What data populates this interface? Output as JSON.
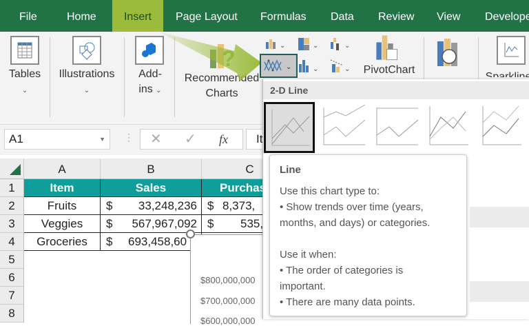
{
  "tabs": [
    "File",
    "Home",
    "Insert",
    "Page Layout",
    "Formulas",
    "Data",
    "Review",
    "View",
    "Develope"
  ],
  "active_tab": "Insert",
  "ribbon": {
    "tables": "Tables",
    "illustrations": "Illustrations",
    "addins_1": "Add-",
    "addins_2": "ins",
    "recommended_1": "Recommended",
    "recommended_2": "Charts",
    "pivotchart": "PivotChart",
    "map3d": "3D",
    "sparklines": "Sparklines"
  },
  "formula_bar": {
    "name_box": "A1",
    "fx": "fx",
    "content": "It"
  },
  "columns": [
    "A",
    "B",
    "C"
  ],
  "rows": [
    "1",
    "2",
    "3",
    "4",
    "5",
    "6",
    "7",
    "8"
  ],
  "table": {
    "headers": [
      "Item",
      "Sales",
      "Purchas"
    ],
    "data": [
      [
        "Fruits",
        "$",
        "33,248,236",
        "$",
        "8,373,"
      ],
      [
        "Veggies",
        "$",
        "567,967,092",
        "$",
        "535,"
      ],
      [
        "Groceries",
        "$",
        "693,458,60",
        "",
        ""
      ]
    ]
  },
  "chart_axis": [
    "$800,000,000",
    "$700,000,000",
    "$600,000,000"
  ],
  "dropdown": {
    "section": "2-D Line"
  },
  "tooltip": {
    "title": "Line",
    "l1": "Use this chart type to:",
    "l2": "• Show trends over time (years,",
    "l3": "months, and days) or categories.",
    "l4": "Use it when:",
    "l5": "• The order of categories is",
    "l6": "important.",
    "l7": "• There are many data points."
  },
  "colors": {
    "tab_bar": "#217346",
    "insert_highlight": "#9bbb3a",
    "table_header": "#0f9e9a"
  }
}
